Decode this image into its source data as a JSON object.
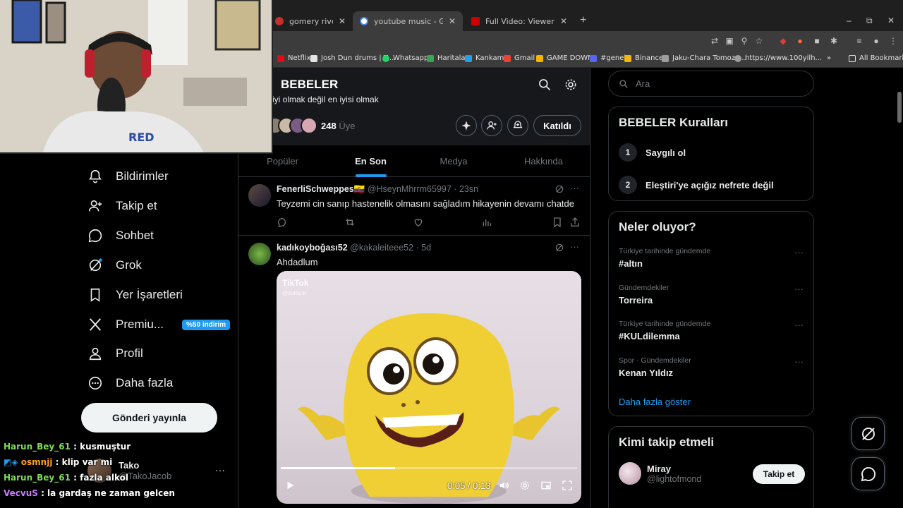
{
  "browser": {
    "tabs": [
      {
        "title": "gomery riverfront brawl -",
        "color": "#c4302b"
      },
      {
        "title": "youtube music - Google'da Ara",
        "color": "#4285f4"
      },
      {
        "title": "Full Video: Viewer records as M",
        "color": "#cc0000"
      }
    ],
    "new_tab": "+",
    "window_controls": {
      "minimize": "–",
      "restore": "⧉",
      "close": "✕"
    },
    "bookmarks": [
      {
        "label": "Netflix",
        "color": "#e50914"
      },
      {
        "label": "Josh Dun drums | T...",
        "color": "#e3e3e3"
      },
      {
        "label": "Whatsapp",
        "color": "#25d366"
      },
      {
        "label": "Haritalar",
        "color": "#34a853"
      },
      {
        "label": "Kankam",
        "color": "#1da1f2"
      },
      {
        "label": "Gmail",
        "color": "#ea4335"
      },
      {
        "label": "GAME DOWN",
        "color": "#f4b400"
      },
      {
        "label": "#genel",
        "color": "#5865f2"
      },
      {
        "label": "Binance",
        "color": "#f0b90b"
      },
      {
        "label": "Jaku-Chara Tomoza...",
        "color": "#9e9e9e"
      },
      {
        "label": "https://www.100yilh...",
        "color": "#9e9e9e"
      }
    ],
    "bookmarks_more": "»",
    "all_bookmarks": "All Bookmarks"
  },
  "nav": {
    "items": [
      {
        "label": "Bildirimler",
        "icon": "bell-icon"
      },
      {
        "label": "Takip et",
        "icon": "person-add-icon"
      },
      {
        "label": "Sohbet",
        "icon": "chat-icon"
      },
      {
        "label": "Grok",
        "icon": "grok-icon"
      },
      {
        "label": "Yer İşaretleri",
        "icon": "bookmark-icon"
      },
      {
        "label": "Premiu...",
        "icon": "x-logo-icon",
        "badge": "%50 indirim"
      },
      {
        "label": "Profil",
        "icon": "person-icon"
      },
      {
        "label": "Daha fazla",
        "icon": "more-circle-icon"
      }
    ],
    "post_button": "Gönderi yayınla",
    "account": {
      "name": "Tako",
      "handle": "@TakoJacob",
      "more": "···"
    }
  },
  "chat": [
    {
      "user": "Harun_Bey_61",
      "text": ": kusmuştur",
      "color": "#7ed957"
    },
    {
      "user": "osmnjj",
      "text": ": klip var mi",
      "color": "#ff9f1a"
    },
    {
      "user": "Harun_Bey_61",
      "text": ": fazla alkol",
      "color": "#7ed957"
    },
    {
      "user": "VecvuS",
      "text": ": la gardaş ne zaman gelcen",
      "color": "#c77dff"
    }
  ],
  "community": {
    "title": "BEBELER",
    "description": "iyi olmak değil en iyisi olmak",
    "member_count": "248",
    "member_label": "Üye",
    "joined_button": "Katıldı",
    "tabs": [
      "Popüler",
      "En Son",
      "Medya",
      "Hakkında"
    ],
    "active_tab": "En Son"
  },
  "posts": [
    {
      "name": "FenerliSchweppes🇪🇨",
      "handle": "@HseynMhrrm65997",
      "time": "23sn",
      "text": "Teyzemi cin sanıp hastenelik olmasını sağladım hikayenin devamı chatde",
      "more": "···"
    },
    {
      "name": "kadıkoyboğası52",
      "handle": "@kakaleiteee52",
      "time": "5d",
      "text": "Ahdadlum",
      "more": "···",
      "video": {
        "watermark": "TikTok",
        "watermark_user": "@zurlann",
        "time": "0:05 / 0:13",
        "progress": 0.385
      }
    }
  ],
  "sidebar": {
    "search_placeholder": "Ara",
    "rules": {
      "title": "BEBELER Kuralları",
      "items": [
        {
          "num": "1",
          "text": "Saygılı ol"
        },
        {
          "num": "2",
          "text": "Eleştiri'ye açığız nefrete değil"
        }
      ]
    },
    "trends": {
      "title": "Neler oluyor?",
      "items": [
        {
          "context": "Türkiye tarihinde gündemde",
          "name": "#altın"
        },
        {
          "context": "Gündemdekiler",
          "name": "Torreira"
        },
        {
          "context": "Türkiye tarihinde gündemde",
          "name": "#KULdilemma"
        },
        {
          "context": "Spor · Gündemdekiler",
          "name": "Kenan Yıldız"
        }
      ],
      "more_icon": "···",
      "show_more": "Daha fazla göster"
    },
    "who_to_follow": {
      "title": "Kimi takip etmeli",
      "user": {
        "name": "Miray",
        "handle": "@lightofmond"
      },
      "follow_button": "Takip et"
    }
  }
}
